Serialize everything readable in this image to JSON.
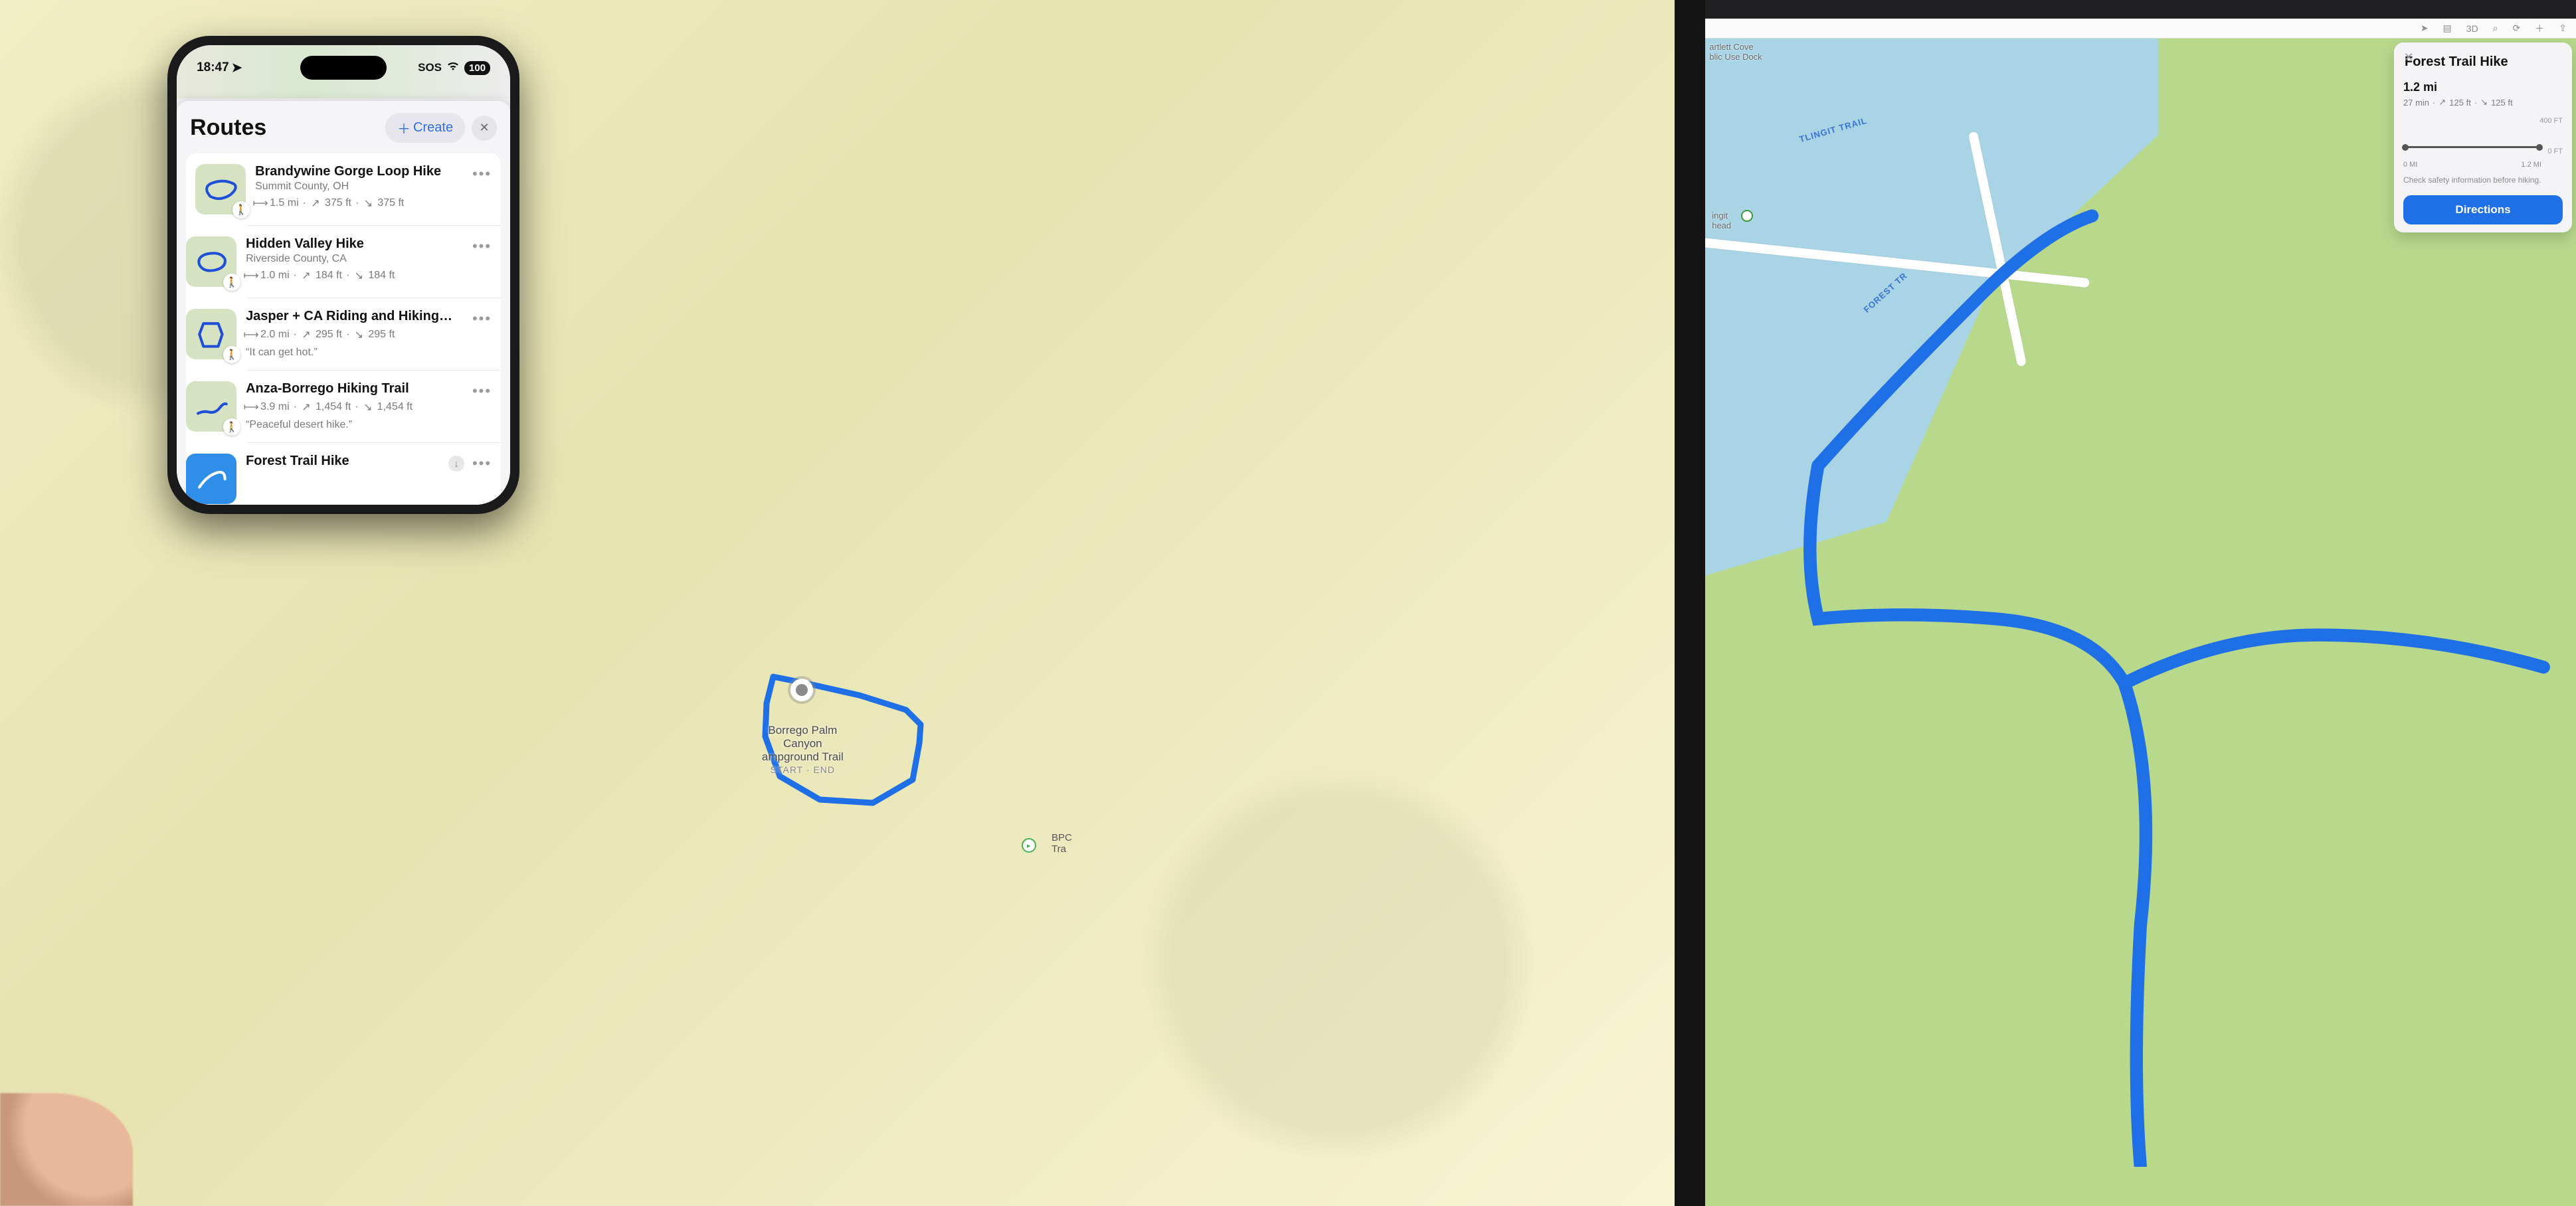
{
  "status": {
    "time": "18:47",
    "sos": "SOS",
    "battery": "100"
  },
  "sheet": {
    "title": "Routes",
    "create_label": "Create"
  },
  "routes": [
    {
      "title": "Brandywine Gorge Loop Hike",
      "subtitle": "Summit County, OH",
      "distance": "1.5 mi",
      "ascent": "375 ft",
      "descent": "375 ft"
    },
    {
      "title": "Hidden Valley Hike",
      "subtitle": "Riverside County, CA",
      "distance": "1.0 mi",
      "ascent": "184 ft",
      "descent": "184 ft"
    },
    {
      "title": "Jasper + CA Riding and Hiking…",
      "distance": "2.0 mi",
      "ascent": "295 ft",
      "descent": "295 ft",
      "quote": "“It can get hot.”"
    },
    {
      "title": "Anza-Borrego Hiking Trail",
      "distance": "3.9 mi",
      "ascent": "1,454 ft",
      "descent": "1,454 ft",
      "quote": "“Peaceful desert hike.”"
    },
    {
      "title": "Forest Trail Hike"
    }
  ],
  "ipad_left": {
    "label_line1": "Borrego Palm",
    "label_line2": "Canyon",
    "label_line3": "ampground Trail",
    "label_sub": "START · END",
    "poi_label": "BPC\nTra"
  },
  "ipad_right": {
    "toolbar_3d": "3D",
    "cove": "artlett Cove\nblic Use Dock",
    "thead": "ingit\nhead",
    "trail1": "TLINGIT TRAIL",
    "trail2": "FOREST TR",
    "panel": {
      "title": "Forest Trail Hike",
      "distance": "1.2 mi",
      "duration": "27 min",
      "ascent": "125 ft",
      "descent": "125 ft",
      "y_top": "400 FT",
      "y_bot": "0 FT",
      "x_start": "0 MI",
      "x_end": "1.2 MI",
      "note": "Check safety information before hiking.",
      "directions": "Directions"
    }
  }
}
